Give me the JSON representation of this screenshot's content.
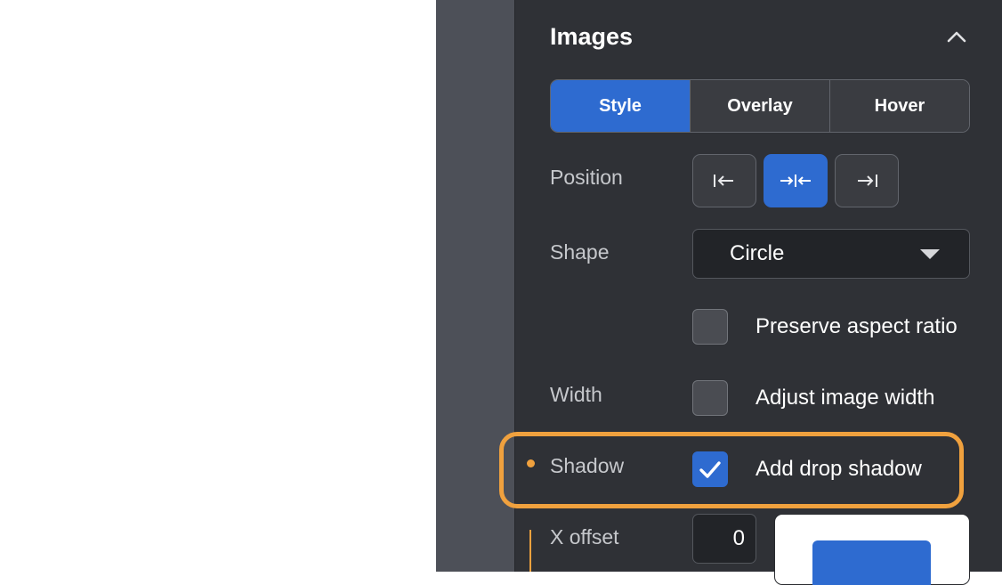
{
  "panel": {
    "title": "Images",
    "tabs": [
      {
        "label": "Style",
        "active": true
      },
      {
        "label": "Overlay",
        "active": false
      },
      {
        "label": "Hover",
        "active": false
      }
    ],
    "position": {
      "label": "Position",
      "options": [
        {
          "icon": "align-left-icon",
          "active": false
        },
        {
          "icon": "align-center-icon",
          "active": true
        },
        {
          "icon": "align-right-icon",
          "active": false
        }
      ]
    },
    "shape": {
      "label": "Shape",
      "value": "Circle"
    },
    "preserve_aspect": {
      "label": "Preserve aspect ratio",
      "checked": false
    },
    "width": {
      "label": "Width",
      "checkbox_label": "Adjust image width",
      "checked": false
    },
    "shadow": {
      "label": "Shadow",
      "checkbox_label": "Add drop shadow",
      "checked": true
    },
    "x_offset": {
      "label": "X offset",
      "value": "0"
    }
  },
  "colors": {
    "accent": "#2e6bd0",
    "highlight": "#f0a13e",
    "panel_bg": "#2f3136"
  }
}
